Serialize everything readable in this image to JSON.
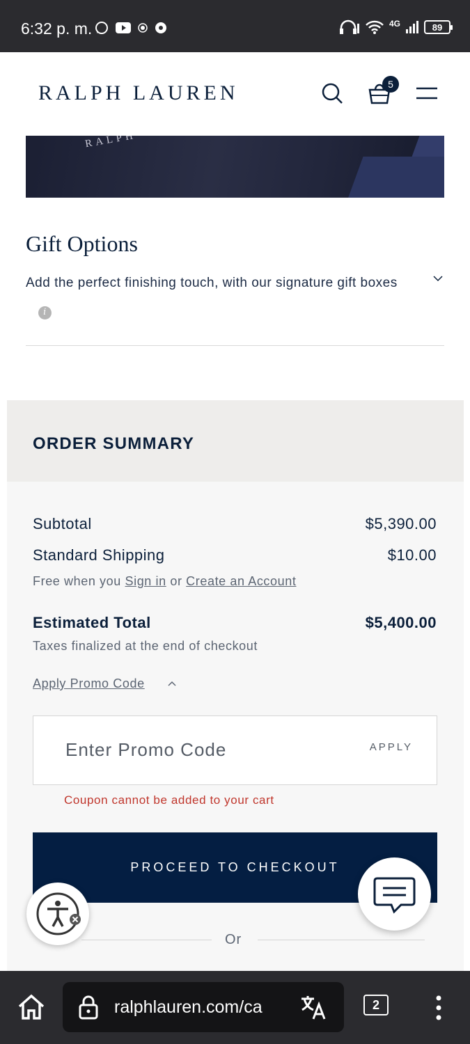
{
  "status_bar": {
    "time": "6:32 p. m.",
    "network": "4G",
    "battery": "89"
  },
  "header": {
    "brand": "RALPH LAUREN",
    "cart_count": "5"
  },
  "gift_image": {
    "caption": "RALPH"
  },
  "gift_options": {
    "title": "Gift Options",
    "description": "Add the perfect finishing touch, with our signature gift boxes"
  },
  "order_summary": {
    "title": "ORDER SUMMARY",
    "subtotal_label": "Subtotal",
    "subtotal_value": "$5,390.00",
    "shipping_label": "Standard Shipping",
    "shipping_value": "$10.00",
    "shipping_note_prefix": "Free when you",
    "sign_in_link": "Sign in",
    "shipping_note_or": "or",
    "create_account_link": "Create an Account",
    "total_label": "Estimated Total",
    "total_value": "$5,400.00",
    "tax_note": "Taxes finalized at the end of checkout",
    "promo_link": "Apply Promo Code",
    "promo_placeholder": "Enter Promo Code",
    "apply_label": "APPLY",
    "promo_error": "Coupon cannot be added to your cart",
    "checkout_label": "PROCEED TO CHECKOUT",
    "or_label": "Or"
  },
  "browser": {
    "url": "ralphlauren.com/ca",
    "tab_count": "2"
  },
  "colors": {
    "brand_navy": "#041e42",
    "error_red": "#c0362c",
    "summary_header_bg": "#eeedeb"
  },
  "icons": [
    "whatsapp-icon",
    "youtube-icon",
    "search-icon",
    "bag-icon",
    "menu-icon",
    "chevron-down-icon",
    "chevron-up-icon",
    "info-icon",
    "accessibility-icon",
    "chat-icon",
    "home-icon",
    "lock-icon",
    "translate-icon",
    "more-icon"
  ]
}
